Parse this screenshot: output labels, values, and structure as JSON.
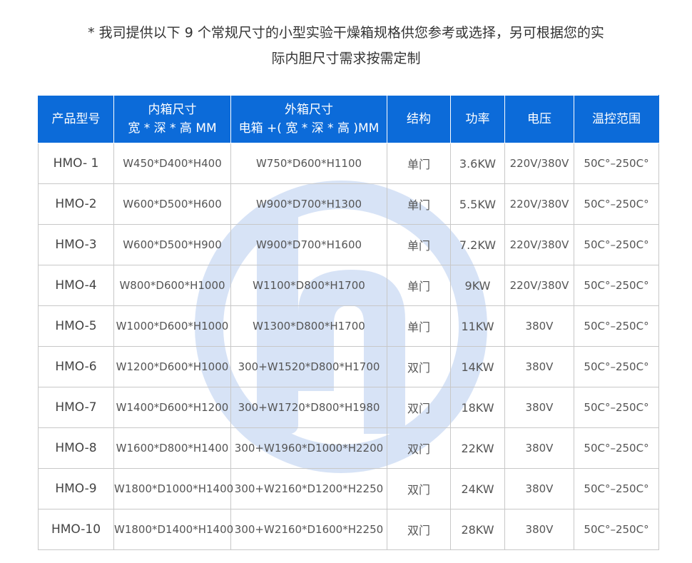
{
  "intro": {
    "line1": "* 我司提供以下 9 个常规尺寸的小型实验干燥箱规格供您参考或选择，另可根据您的实",
    "line2": "际内胆尺寸需求按需定制"
  },
  "table": {
    "headers": [
      {
        "line1": "产品型号",
        "line2": ""
      },
      {
        "line1": "内箱尺寸",
        "line2": "宽 * 深 * 高 MM"
      },
      {
        "line1": "外箱尺寸",
        "line2": "电箱 +( 宽 * 深 * 高 )MM"
      },
      {
        "line1": "结构",
        "line2": ""
      },
      {
        "line1": "功率",
        "line2": ""
      },
      {
        "line1": "电压",
        "line2": ""
      },
      {
        "line1": "温控范围",
        "line2": ""
      }
    ],
    "rows": [
      [
        "HMO- 1",
        "W450*D400*H400",
        "W750*D600*H1100",
        "单门",
        "3.6KW",
        "220V/380V",
        "50C°–250C°"
      ],
      [
        "HMO-2",
        "W600*D500*H600",
        "W900*D700*H1300",
        "单门",
        "5.5KW",
        "220V/380V",
        "50C°–250C°"
      ],
      [
        "HMO-3",
        "W600*D500*H900",
        "W900*D700*H1600",
        "单门",
        "7.2KW",
        "220V/380V",
        "50C°–250C°"
      ],
      [
        "HMO-4",
        "W800*D600*H1000",
        "W1100*D800*H1700",
        "单门",
        "9KW",
        "220V/380V",
        "50C°–250C°"
      ],
      [
        "HMO-5",
        "W1000*D600*H1000",
        "W1300*D800*H1700",
        "单门",
        "11KW",
        "380V",
        "50C°–250C°"
      ],
      [
        "HMO-6",
        "W1200*D600*H1000",
        "300+W1520*D800*H1700",
        "双门",
        "14KW",
        "380V",
        "50C°–250C°"
      ],
      [
        "HMO-7",
        "W1400*D600*H1200",
        "300+W1720*D800*H1980",
        "双门",
        "18KW",
        "380V",
        "50C°–250C°"
      ],
      [
        "HMO-8",
        "W1600*D800*H1400",
        "300+W1960*D1000*H2200",
        "双门",
        "22KW",
        "380V",
        "50C°–250C°"
      ],
      [
        "HMO-9",
        "W1800*D1000*H1400",
        "300+W2160*D1200*H2250",
        "双门",
        "24KW",
        "380V",
        "50C°–250C°"
      ],
      [
        "HMO-10",
        "W1800*D1400*H1400",
        "300+W2160*D1600*H2250",
        "双门",
        "28KW",
        "380V",
        "50C°–250C°"
      ]
    ]
  },
  "colors": {
    "header_bg": "#0c6bd9",
    "watermark": "#1a5fd0"
  },
  "watermark_icon": "hm-circle-logo"
}
